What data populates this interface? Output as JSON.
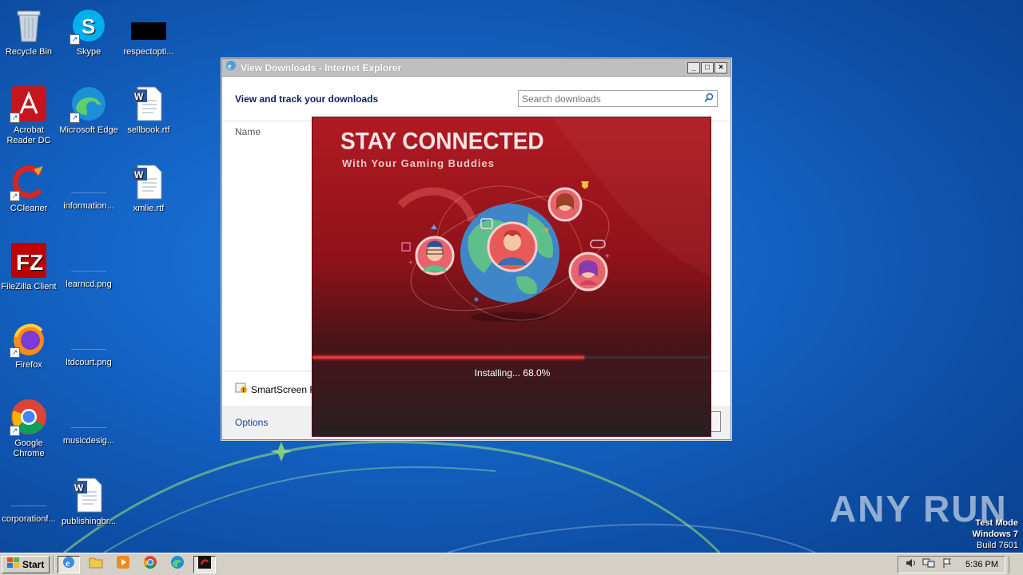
{
  "desktop": {
    "icons": [
      {
        "label": "Recycle Bin"
      },
      {
        "label": "Skype"
      },
      {
        "label": "respectopti..."
      },
      {
        "label": "Acrobat Reader DC"
      },
      {
        "label": "Microsoft Edge"
      },
      {
        "label": "sellbook.rtf"
      },
      {
        "label": "CCleaner"
      },
      {
        "label": "information..."
      },
      {
        "label": "xmlie.rtf"
      },
      {
        "label": "FileZilla Client"
      },
      {
        "label": "learncd.png"
      },
      {
        "label": "Firefox"
      },
      {
        "label": "ltdcourt.png"
      },
      {
        "label": "Google Chrome"
      },
      {
        "label": "musicdesig..."
      },
      {
        "label": "corporationf..."
      },
      {
        "label": "publishingbr..."
      }
    ]
  },
  "ie_window": {
    "title": "View Downloads - Internet Explorer",
    "heading": "View and track your downloads",
    "search_placeholder": "Search downloads",
    "column_name": "Name",
    "smartscreen": "SmartScreen F",
    "options": "Options"
  },
  "installer": {
    "title": "STAY CONNECTED",
    "subtitle": "With Your Gaming Buddies",
    "progress_percent": 68.0,
    "status": "Installing... 68.0%"
  },
  "watermark": "ANY RUN",
  "system": {
    "test_mode": "Test Mode",
    "os": "Windows 7",
    "build": "Build 7601"
  },
  "taskbar": {
    "start": "Start",
    "clock": "5:36 PM"
  },
  "colors": {
    "desktop_blue": "#1565c8",
    "installer_red": "#b01a22",
    "progress_red": "#e43b3b"
  }
}
